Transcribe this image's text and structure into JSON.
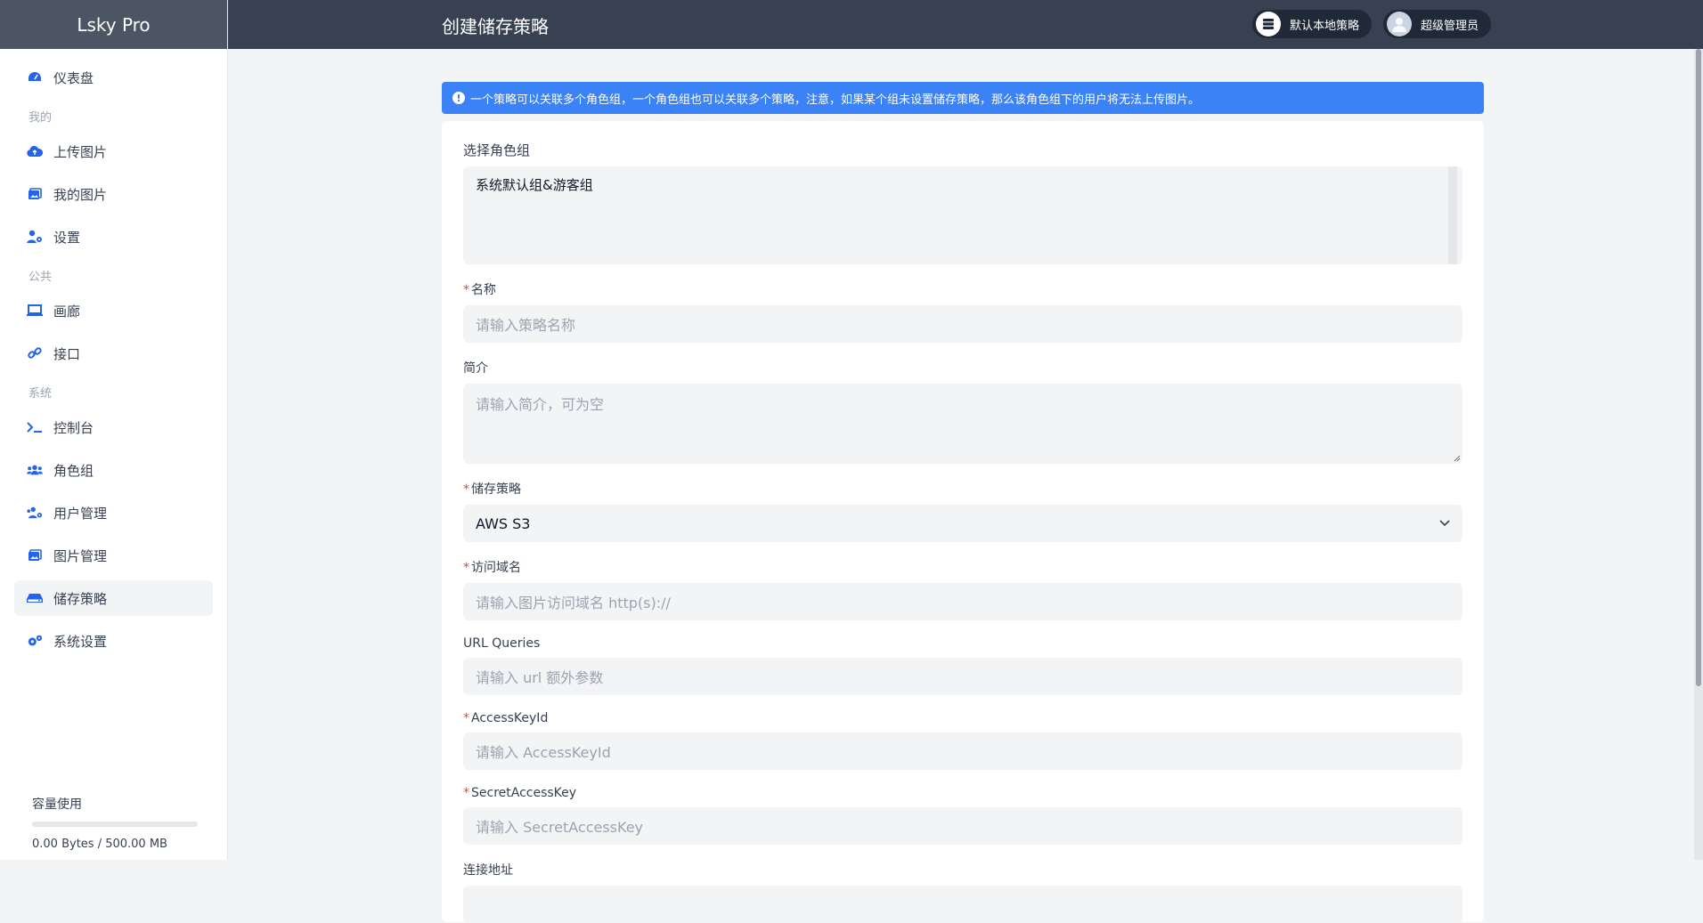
{
  "app": {
    "title": "Lsky Pro"
  },
  "header": {
    "title": "创建储存策略",
    "strategy_pill": {
      "label": "默认本地策略",
      "icon": "server-icon"
    },
    "user_pill": {
      "label": "超级管理员",
      "icon": "avatar"
    }
  },
  "sidebar": {
    "items_top": [
      {
        "label": "仪表盘",
        "icon": "dashboard-icon"
      }
    ],
    "group_mine": "我的",
    "items_mine": [
      {
        "label": "上传图片",
        "icon": "cloud-upload-icon"
      },
      {
        "label": "我的图片",
        "icon": "images-icon"
      },
      {
        "label": "设置",
        "icon": "user-gear-icon"
      }
    ],
    "group_public": "公共",
    "items_public": [
      {
        "label": "画廊",
        "icon": "laptop-icon"
      },
      {
        "label": "接口",
        "icon": "link-icon"
      }
    ],
    "group_system": "系统",
    "items_system": [
      {
        "label": "控制台",
        "icon": "terminal-icon"
      },
      {
        "label": "角色组",
        "icon": "users-icon"
      },
      {
        "label": "用户管理",
        "icon": "users-gear-icon"
      },
      {
        "label": "图片管理",
        "icon": "images-icon"
      },
      {
        "label": "储存策略",
        "icon": "hdd-icon",
        "active": true
      },
      {
        "label": "系统设置",
        "icon": "gears-icon"
      }
    ],
    "quota": {
      "title": "容量使用",
      "text": "0.00 Bytes / 500.00 MB",
      "used_fraction": 0.0
    }
  },
  "alert": {
    "text": "一个策略可以关联多个角色组，一个角色组也可以关联多个策略，注意，如果某个组未设置储存策略，那么该角色组下的用户将无法上传图片。",
    "icon": "info-icon"
  },
  "form": {
    "role_group": {
      "label": "选择角色组",
      "options": [
        "系统默认组&游客组"
      ]
    },
    "name": {
      "label": "名称",
      "required": true,
      "placeholder": "请输入策略名称"
    },
    "intro": {
      "label": "简介",
      "required": false,
      "placeholder": "请输入简介，可为空"
    },
    "storage": {
      "label": "储存策略",
      "required": true,
      "value": "AWS S3"
    },
    "domain": {
      "label": "访问域名",
      "required": true,
      "placeholder": "请输入图片访问域名 http(s)://"
    },
    "queries": {
      "label": "URL Queries",
      "required": false,
      "placeholder": "请输入 url 额外参数"
    },
    "access_key": {
      "label": "AccessKeyId",
      "required": true,
      "placeholder": "请输入 AccessKeyId"
    },
    "secret_key": {
      "label": "SecretAccessKey",
      "required": true,
      "placeholder": "请输入 SecretAccessKey"
    },
    "endpoint": {
      "label": "连接地址",
      "required": false
    }
  },
  "colors": {
    "accent": "#3b82f6",
    "topbar": "#374151",
    "brand": "#4b5563"
  }
}
